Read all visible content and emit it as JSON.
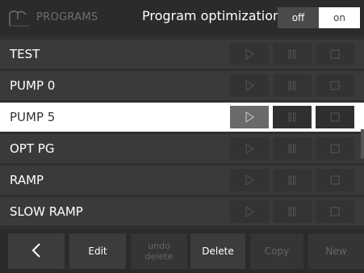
{
  "header": {
    "title": "PROGRAMS",
    "optimization_label": "Program optimization:",
    "toggle_off": "off",
    "toggle_on": "on",
    "toggle_state": "off"
  },
  "programs": [
    {
      "label": "TEST",
      "selected": false
    },
    {
      "label": "PUMP 0",
      "selected": false
    },
    {
      "label": "PUMP 5",
      "selected": true
    },
    {
      "label": "OPT PG",
      "selected": false
    },
    {
      "label": "RAMP",
      "selected": false
    },
    {
      "label": "SLOW RAMP",
      "selected": false
    }
  ],
  "controls": {
    "play_icon": "play-icon",
    "pause_icon": "pause-icon",
    "stop_icon": "stop-icon"
  },
  "bottom_bar": {
    "back_icon": "chevron-left-icon",
    "edit": "Edit",
    "undo_delete": "undo\ndelete",
    "delete": "Delete",
    "copy": "Copy",
    "new": "New"
  },
  "colors": {
    "background": "#2f2f2f",
    "row": "#3a3a3a",
    "selected_row": "#ffffff",
    "disabled_text": "#666666"
  }
}
